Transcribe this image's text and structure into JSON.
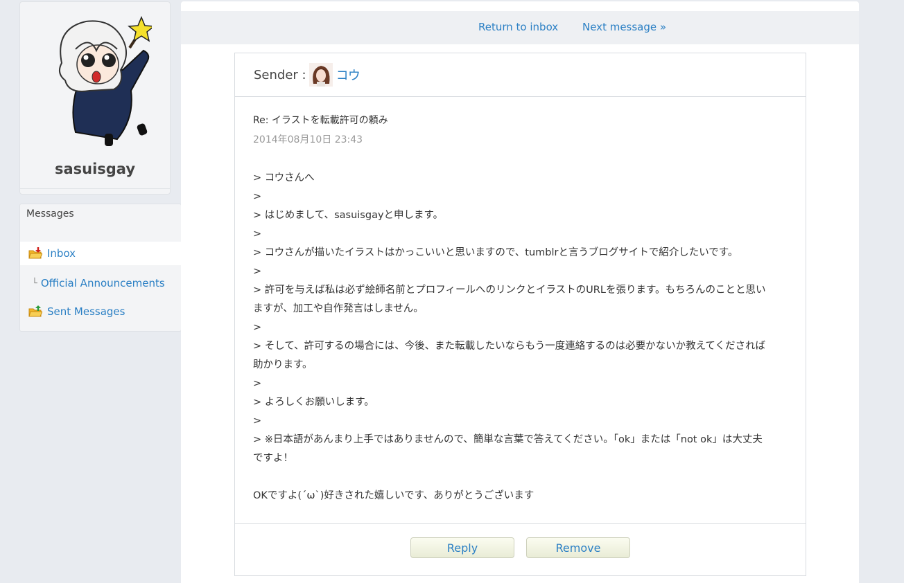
{
  "profile": {
    "username": "sasuisgay"
  },
  "nav": {
    "title": "Messages",
    "items": [
      {
        "label": "Inbox",
        "icon": "folder-inbox-icon"
      },
      {
        "label": "Official Announcements",
        "prefix": "└"
      },
      {
        "label": "Sent Messages",
        "icon": "folder-sent-icon"
      }
    ]
  },
  "topbar": {
    "return_label": "Return to inbox",
    "next_label": "Next message »"
  },
  "message": {
    "sender_label": "Sender :",
    "sender_name": "コウ",
    "subject": "Re: イラストを転載許可の頼み",
    "date": "2014年08月10日 23:43",
    "lines": [
      "> コウさんへ",
      ">",
      "> はじめまして、sasuisgayと申します。",
      ">",
      "> コウさんが描いたイラストはかっこいいと思いますので、tumblrと言うブログサイトで紹介したいです。",
      ">",
      "> 許可を与えば私は必ず絵師名前とプロフィールへのリンクとイラストのURLを張ります。もちろんのことと思い",
      "ますが、加工や自作発言はしません。",
      ">",
      "> そして、許可するの場合には、今後、また転載したいならもう一度連絡するのは必要かないか教えてくだされば",
      "助かります。",
      ">",
      "> よろしくお願いします。",
      ">",
      "> ※日本語があんまり上手ではありませんので、簡単な言葉で答えてください。「ok」または「not ok」は大丈夫",
      "ですよ！",
      "",
      "OKですよ(´ω`)好きされた嬉しいです、ありがとうございます"
    ]
  },
  "actions": {
    "reply_label": "Reply",
    "remove_label": "Remove"
  },
  "colors": {
    "link": "#2a7fc4",
    "background": "#e8ebf0",
    "button_bg": "#f1f3e3"
  }
}
